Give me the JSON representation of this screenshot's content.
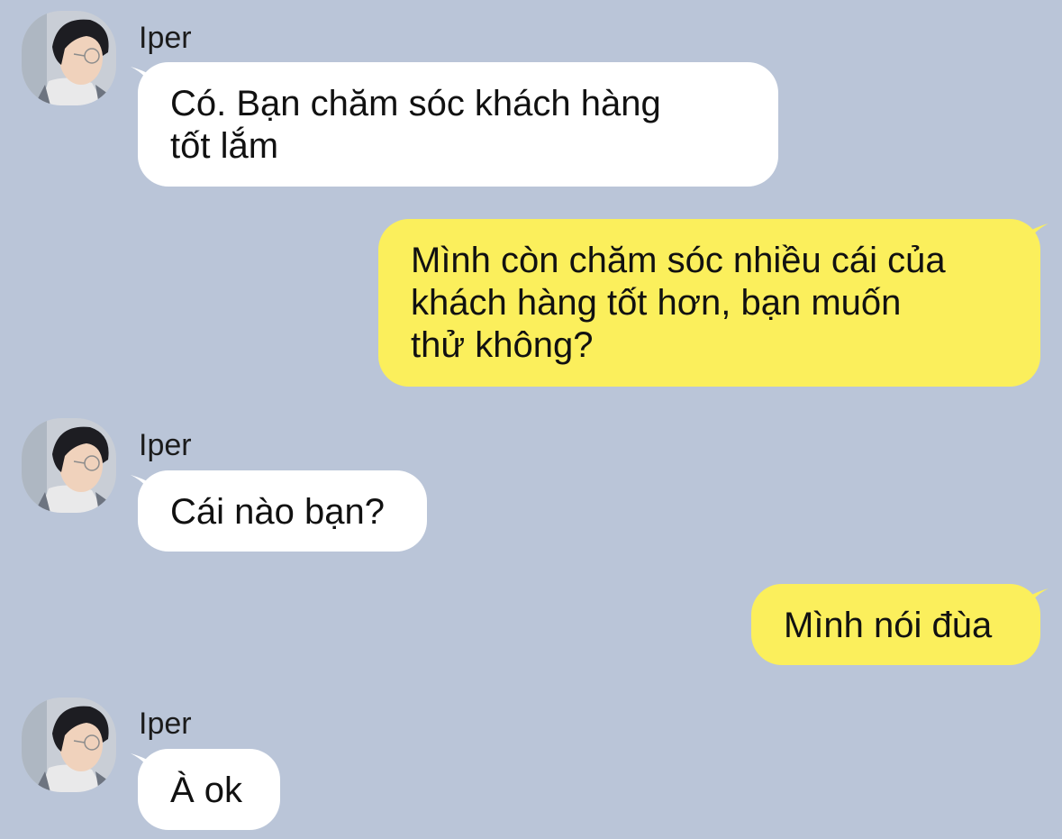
{
  "colors": {
    "background": "#bac5d8",
    "incoming_bubble": "#ffffff",
    "outgoing_bubble": "#fbef5c"
  },
  "messages": [
    {
      "direction": "incoming",
      "sender": "Iper",
      "avatar_icon": "user-avatar-icon",
      "text": "Có. Bạn chăm sóc khách hàng\ntốt lắm"
    },
    {
      "direction": "outgoing",
      "text": "Mình còn chăm sóc nhiều cái của\nkhách hàng tốt hơn, bạn muốn\nthử không?"
    },
    {
      "direction": "incoming",
      "sender": "Iper",
      "avatar_icon": "user-avatar-icon",
      "text": "Cái nào bạn?"
    },
    {
      "direction": "outgoing",
      "text": "Mình nói đùa"
    },
    {
      "direction": "incoming",
      "sender": "Iper",
      "avatar_icon": "user-avatar-icon",
      "text": "À ok"
    }
  ]
}
